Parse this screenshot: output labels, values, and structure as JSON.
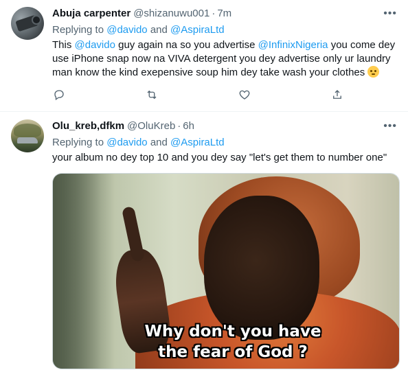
{
  "tweets": [
    {
      "author_name": "Abuja carpenter",
      "handle": "@shizanuwu001",
      "separator": "·",
      "time": "7m",
      "more_icon": "more-horizontal-icon",
      "replying_label": "Replying to",
      "replying_mention_1": "@davido",
      "replying_and": "and",
      "replying_mention_2": "@AspiraLtd",
      "text_parts": {
        "p1": "This ",
        "m1": "@davido",
        "p2": " guy again na so you advertise ",
        "m2": "@InfinixNigeria",
        "p3": " you come dey use iPhone snap now na VIVA detergent you dey advertise only ur laundry man know the kind exepensive soup him dey take wash your clothes "
      },
      "emoji": "face-with-rolling-eyes",
      "actions": [
        "reply-icon",
        "retweet-icon",
        "like-icon",
        "share-icon"
      ]
    },
    {
      "author_name": "Olu_kreb,dfkm",
      "handle": "@OluKreb",
      "separator": "·",
      "time": "6h",
      "more_icon": "more-horizontal-icon",
      "replying_label": "Replying to",
      "replying_mention_1": "@davido",
      "replying_and": "and",
      "replying_mention_2": "@AspiraLtd",
      "text": "your album no dey top 10 and you dey say \"let's get them to number one\"",
      "media": {
        "caption_line_1": "Why don't you have",
        "caption_line_2": "the fear of God ?"
      }
    }
  ],
  "colors": {
    "link": "#1d9bf0",
    "secondary_text": "#536471",
    "primary_text": "#0f1419",
    "divider": "#eff3f4"
  }
}
